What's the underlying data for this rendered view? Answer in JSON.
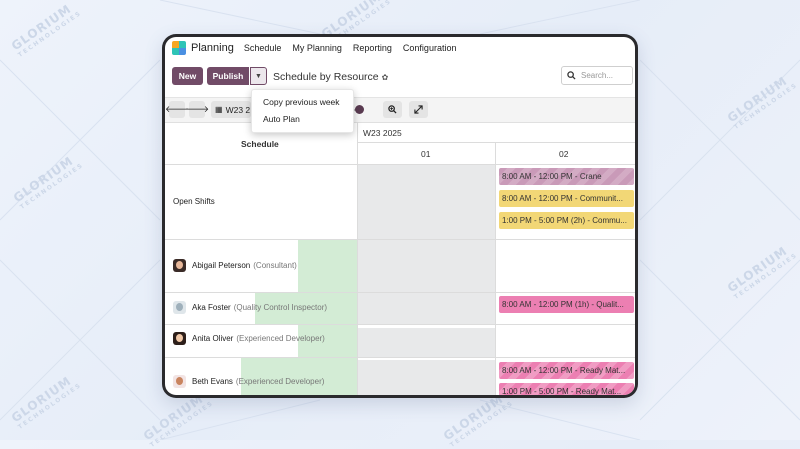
{
  "brand": {
    "watermark": "GLORIUM",
    "watermark_sub": "TECHNOLOGIES"
  },
  "app": {
    "name": "Planning"
  },
  "nav": [
    "Schedule",
    "My Planning",
    "Reporting",
    "Configuration"
  ],
  "control": {
    "new_label": "New",
    "publish_label": "Publish",
    "view_title": "Schedule by Resource",
    "search_placeholder": "Search..."
  },
  "toolbar": {
    "week_label": "W23 2"
  },
  "publish_menu": [
    "Copy previous week",
    "Auto Plan"
  ],
  "schedule": {
    "header_label": "Schedule",
    "period_label": "W23 2025",
    "day_columns": [
      "01",
      "02"
    ],
    "rows": [
      {
        "name": "Open Shifts",
        "role": ""
      },
      {
        "name": "Abigail Peterson",
        "role": "(Consultant)"
      },
      {
        "name": "Aka Foster",
        "role": "(Quality Control Inspector)"
      },
      {
        "name": "Anita Oliver",
        "role": "(Experienced Developer)"
      },
      {
        "name": "Beth Evans",
        "role": "(Experienced Developer)"
      }
    ],
    "shifts": [
      "8:00 AM - 12:00 PM - Crane",
      "8:00 AM - 12:00 PM - Communit...",
      "1:00 PM - 5:00 PM (2h) - Commu...",
      "8:00 AM - 12:00 PM (1h) - Qualit...",
      "8:00 AM - 12:00 PM - Ready Mat...",
      "1:00 PM - 5:00 PM - Ready Mat..."
    ]
  },
  "colors": {
    "accent": "#714b67",
    "shift_yellow": "#f2d776",
    "shift_pink": "#ec7fb2",
    "shift_purple": "#c99ab8",
    "availability_green": "#d3ecd5"
  }
}
